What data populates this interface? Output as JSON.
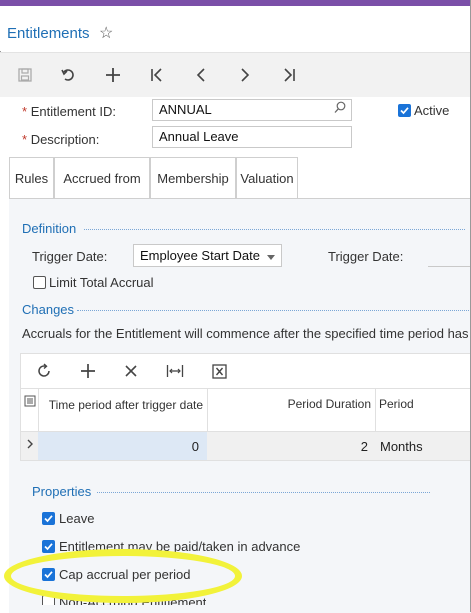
{
  "window": {
    "title": "Entitlements"
  },
  "toolbar": {
    "buttons": [
      "save-icon",
      "undo-icon",
      "add-icon",
      "first-record-icon",
      "previous-record-icon",
      "next-record-icon",
      "last-record-icon"
    ]
  },
  "form": {
    "entitlement_id_label": "Entitlement ID:",
    "entitlement_id_value": "ANNUAL",
    "description_label": "Description:",
    "description_value": "Annual Leave",
    "required_mark": "*",
    "active_label": "Active",
    "active_checked": true
  },
  "tabs": [
    "Rules",
    "Accrued from",
    "Membership",
    "Valuation"
  ],
  "active_tab": "Rules",
  "definition": {
    "title": "Definition",
    "trigger_date_label": "Trigger Date:",
    "trigger_date_value": "Employee Start Date",
    "trigger_date2_label": "Trigger Date:",
    "limit_total_accrual_label": "Limit Total Accrual",
    "limit_total_accrual_checked": false
  },
  "changes": {
    "title": "Changes",
    "description": "Accruals for the Entitlement will commence after the specified time period has"
  },
  "grid": {
    "columns": [
      "Time period after trigger date",
      "Period Duration",
      "Period"
    ],
    "rows": [
      {
        "time_period": "0",
        "duration": "2",
        "period": "Months"
      }
    ]
  },
  "properties": {
    "title": "Properties",
    "items": [
      {
        "label": "Leave",
        "checked": true
      },
      {
        "label": "Entitlement may be paid/taken in advance",
        "checked": true
      },
      {
        "label": "Cap accrual per period",
        "checked": true
      },
      {
        "label": "Non-Accruing Entitlement",
        "checked": false
      }
    ]
  },
  "colors": {
    "accent": "#1f6fb5",
    "checkbox": "#1a73d8",
    "highlight": "#f2f23a",
    "topbar": "#7b4fa8"
  }
}
